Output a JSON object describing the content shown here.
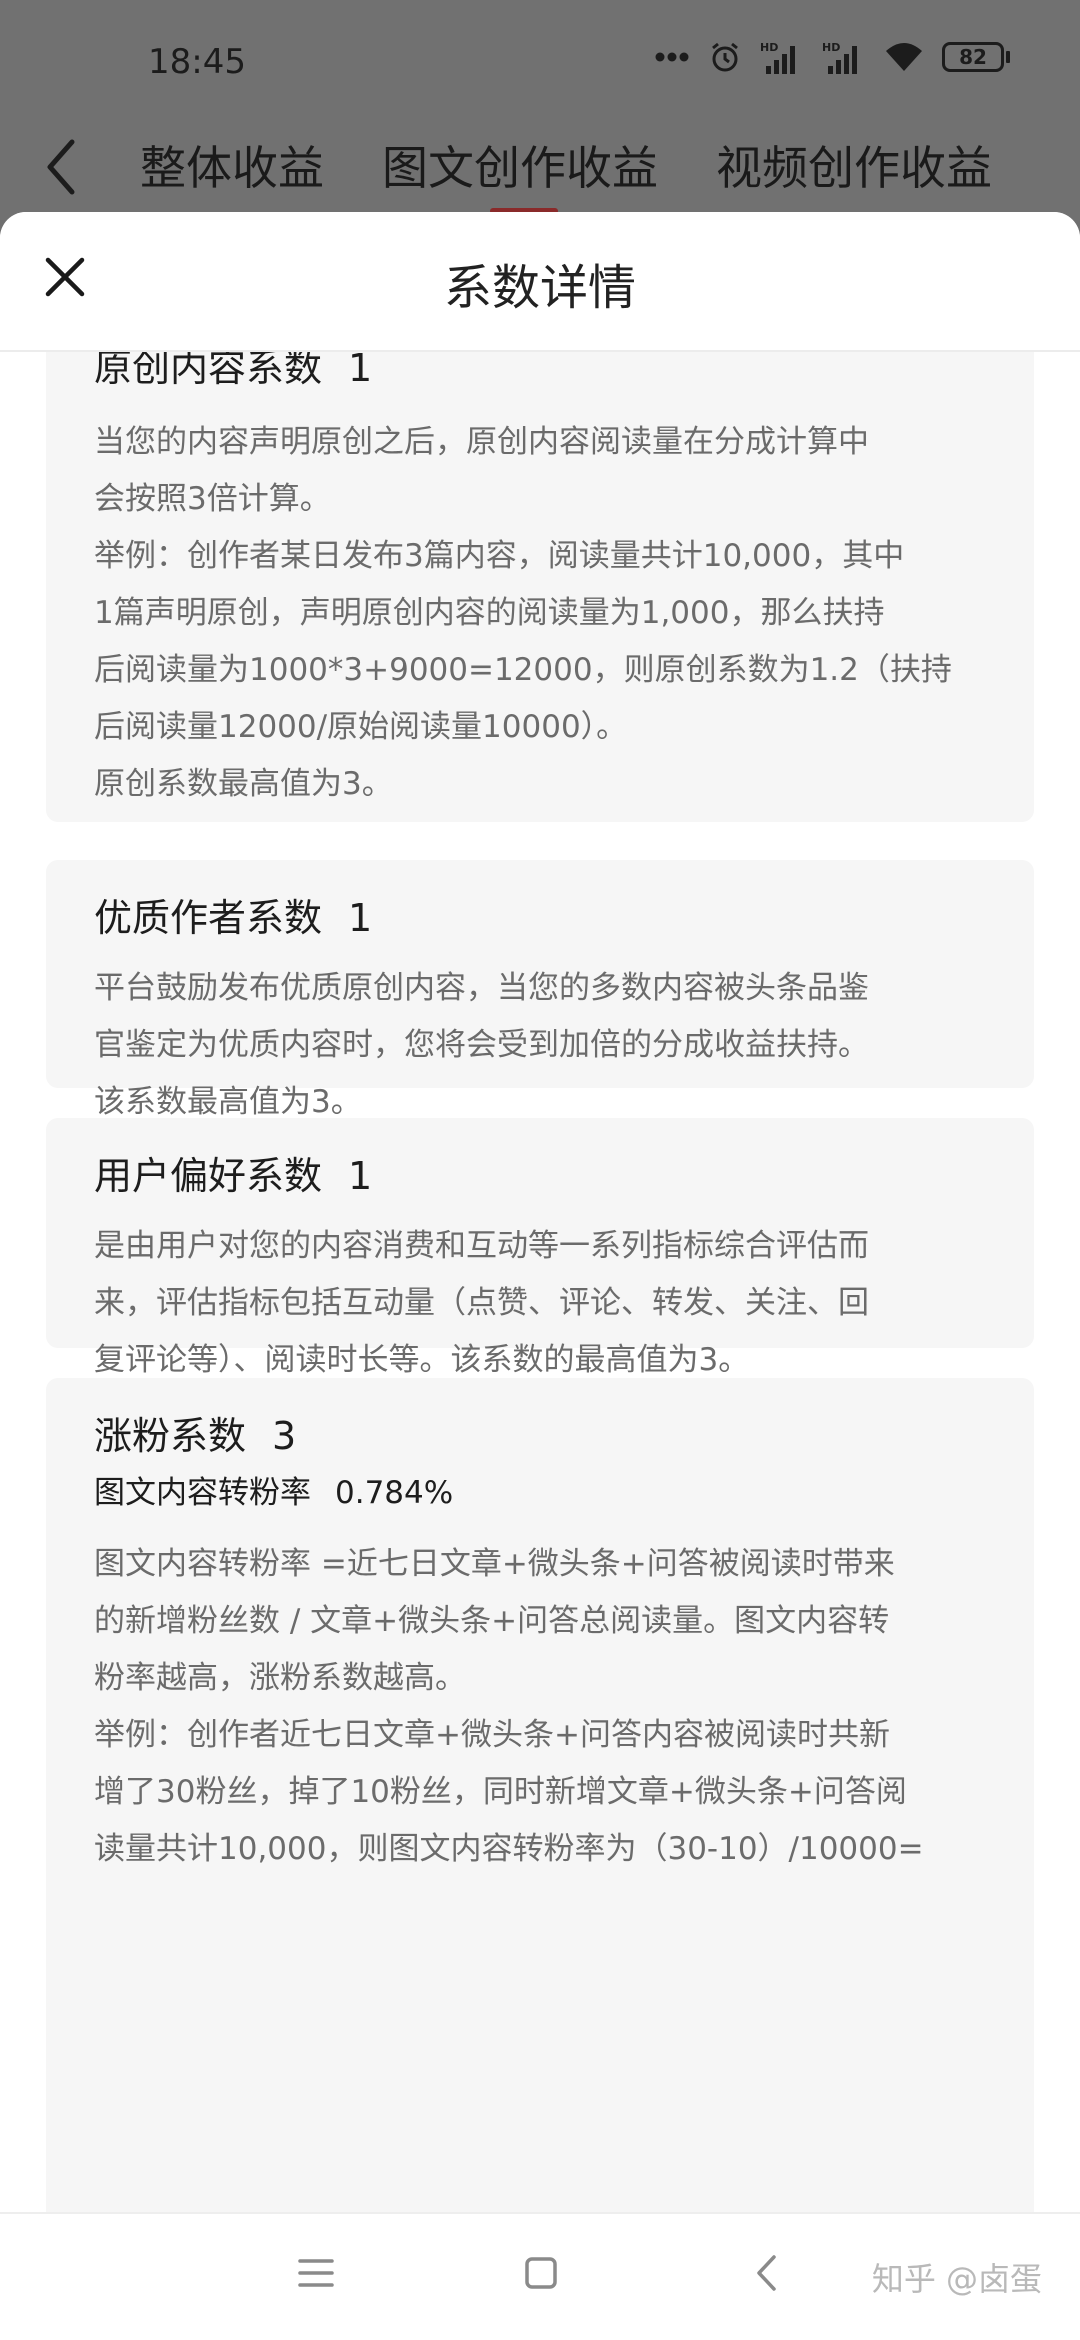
{
  "status_bar": {
    "time": "18:45",
    "battery": "82",
    "icons": [
      "more-dots-icon",
      "alarm-icon",
      "hd-signal-icon",
      "hd-signal-icon",
      "wifi-icon",
      "battery-icon"
    ]
  },
  "top_nav": {
    "tabs": [
      {
        "label": "整体收益"
      },
      {
        "label": "图文创作收益"
      },
      {
        "label": "视频创作收益"
      }
    ],
    "active_tab_index": 1,
    "accent_color": "#8a2a2a"
  },
  "sheet": {
    "title": "系数详情",
    "cards": [
      {
        "title": "原创内容系数",
        "value": "1",
        "lines": [
          "当您的内容声明原创之后，原创内容阅读量在分成计算中",
          "会按照3倍计算。",
          "举例：创作者某日发布3篇内容，阅读量共计10,000，其中",
          "1篇声明原创，声明原创内容的阅读量为1,000，那么扶持",
          "后阅读量为1000*3+9000=12000，则原创系数为1.2（扶持",
          "后阅读量12000/原始阅读量10000）。",
          "原创系数最高值为3。"
        ]
      },
      {
        "title": "优质作者系数",
        "value": "1",
        "lines": [
          "平台鼓励发布优质原创内容，当您的多数内容被头条品鉴",
          "官鉴定为优质内容时，您将会受到加倍的分成收益扶持。",
          "该系数最高值为3。"
        ]
      },
      {
        "title": "用户偏好系数",
        "value": "1",
        "lines": [
          "是由用户对您的内容消费和互动等一系列指标综合评估而",
          "来，评估指标包括互动量（点赞、评论、转发、关注、回",
          "复评论等）、阅读时长等。该系数的最高值为3。"
        ]
      },
      {
        "title": "涨粉系数",
        "value": "3",
        "sub_label": "图文内容转粉率",
        "sub_value": "0.784%",
        "lines": [
          "图文内容转粉率 =近七日文章+微头条+问答被阅读时带来",
          "的新增粉丝数 / 文章+微头条+问答总阅读量。图文内容转",
          "粉率越高，涨粉系数越高。",
          "举例：创作者近七日文章+微头条+问答内容被阅读时共新",
          "增了30粉丝，掉了10粉丝，同时新增文章+微头条+问答阅",
          "读量共计10,000，则图文内容转粉率为（30-10）/10000="
        ]
      }
    ]
  },
  "system_nav": {
    "watermark": "知乎 @卤蛋",
    "icons": [
      "menu-icon",
      "home-square-icon",
      "back-chevron-icon"
    ]
  }
}
